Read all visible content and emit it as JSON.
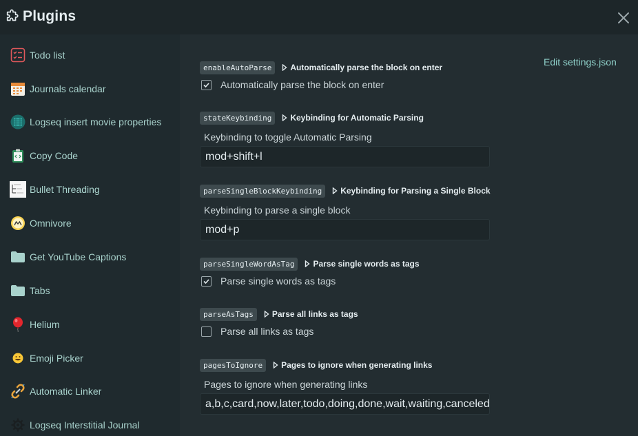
{
  "header": {
    "title": "Plugins",
    "title_icon": "puzzle-icon",
    "close_icon": "close-icon"
  },
  "sidebar": {
    "items": [
      {
        "label": "Todo list",
        "icon": "todo-list-icon"
      },
      {
        "label": "Journals calendar",
        "icon": "calendar-icon"
      },
      {
        "label": "Logseq insert movie properties",
        "icon": "movie-icon"
      },
      {
        "label": "Copy Code",
        "icon": "clipboard-code-icon"
      },
      {
        "label": "Bullet Threading",
        "icon": "bullet-threading-thumbnail-icon"
      },
      {
        "label": "Omnivore",
        "icon": "omnivore-icon"
      },
      {
        "label": "Get YouTube Captions",
        "icon": "folder-icon"
      },
      {
        "label": "Tabs",
        "icon": "folder-icon"
      },
      {
        "label": "Helium",
        "icon": "balloon-icon"
      },
      {
        "label": "Emoji Picker",
        "icon": "emoji-icon"
      },
      {
        "label": "Automatic Linker",
        "icon": "link-icon"
      },
      {
        "label": "Logseq Interstitial Journal",
        "icon": "gear-icon"
      }
    ]
  },
  "main": {
    "edit_settings_label": "Edit settings.json",
    "settings": [
      {
        "key": "enableAutoParse",
        "heading": "Automatically parse the block on enter",
        "type": "checkbox",
        "label": "Automatically parse the block on enter",
        "checked": true
      },
      {
        "key": "stateKeybinding",
        "heading": "Keybinding for Automatic Parsing",
        "type": "text",
        "description": "Keybinding to toggle Automatic Parsing",
        "value": "mod+shift+l"
      },
      {
        "key": "parseSingleBlockKeybinding",
        "heading": "Keybinding for Parsing a Single Block",
        "type": "text",
        "description": "Keybinding to parse a single block",
        "value": "mod+p"
      },
      {
        "key": "parseSingleWordAsTag",
        "heading": "Parse single words as tags",
        "type": "checkbox",
        "label": "Parse single words as tags",
        "checked": true
      },
      {
        "key": "parseAsTags",
        "heading": "Parse all links as tags",
        "type": "checkbox",
        "label": "Parse all links as tags",
        "checked": false
      },
      {
        "key": "pagesToIgnore",
        "heading": "Pages to ignore when generating links",
        "type": "text",
        "description": "Pages to ignore when generating links",
        "value": "a,b,c,card,now,later,todo,doing,done,wait,waiting,canceled"
      }
    ]
  },
  "colors": {
    "accent": "#8fd0c9",
    "sidebar_text": "#a9d3cd",
    "background": "#232d31"
  }
}
